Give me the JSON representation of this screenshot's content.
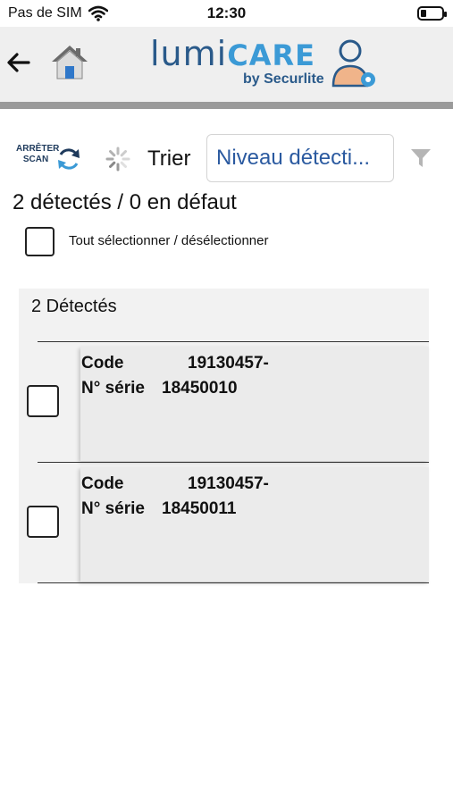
{
  "status_bar": {
    "carrier": "Pas de SIM",
    "time": "12:30"
  },
  "header": {
    "logo_lumi": "lumi",
    "logo_care": "CARE",
    "logo_sub": "by Securlite",
    "icons": [
      "back-arrow-icon",
      "home-icon",
      "user-gear-icon"
    ]
  },
  "toolbar": {
    "stop_scan_line1": "ARRÊTER",
    "stop_scan_line2": "SCAN",
    "sort_label": "Trier",
    "sort_value": "Niveau détecti...",
    "icons": [
      "refresh-icon",
      "spinner-icon",
      "filter-icon"
    ]
  },
  "summary": "2 détectés / 0 en défaut",
  "select_all_label": "Tout sélectionner / désélectionner",
  "group": {
    "title": "2 Détectés",
    "items": [
      {
        "code_label": "Code",
        "code_value": "19130457-",
        "serial_label": "N° série",
        "serial_value": "18450010",
        "checked": false
      },
      {
        "code_label": "Code",
        "code_value": "19130457-",
        "serial_label": "N° série",
        "serial_value": "18450011",
        "checked": false
      }
    ]
  },
  "colors": {
    "brand_dark": "#2a5a8a",
    "brand_light": "#3b9ad6",
    "select_text": "#2b5aa0",
    "header_bg": "#efefef"
  }
}
